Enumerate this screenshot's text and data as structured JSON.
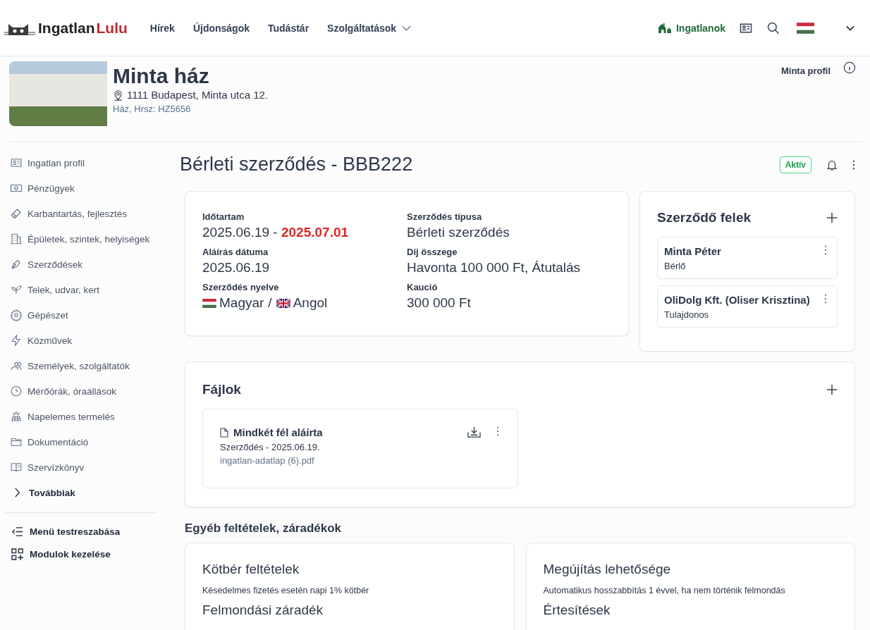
{
  "header": {
    "logo_first": "Ingatlan",
    "logo_second": "Lulu",
    "nav": [
      {
        "label": "Hírek",
        "dropdown": false
      },
      {
        "label": "Újdonságok",
        "dropdown": false
      },
      {
        "label": "Tudástár",
        "dropdown": false
      },
      {
        "label": "Szolgáltatások",
        "dropdown": true
      }
    ],
    "properties_link": "Ingatlanok"
  },
  "property": {
    "name": "Minta ház",
    "address": "1111 Budapest, Minta utca 12.",
    "subtitle": "Ház, Hrsz: HZ5656",
    "profile_link": "Minta profil"
  },
  "sidebar": {
    "items": [
      {
        "label": "Ingatlan profil"
      },
      {
        "label": "Pénzügyek"
      },
      {
        "label": "Karbantartás, fejlesztés"
      },
      {
        "label": "Épületek, szintek, helyiségek"
      },
      {
        "label": "Szerződések"
      },
      {
        "label": "Telek, udvar, kert"
      },
      {
        "label": "Gépészet"
      },
      {
        "label": "Közművek"
      },
      {
        "label": "Személyek, szolgáltatók"
      },
      {
        "label": "Mérőórák, óraállások"
      },
      {
        "label": "Napelemes termelés"
      },
      {
        "label": "Dokumentáció"
      },
      {
        "label": "Szervízkönyv"
      }
    ],
    "more": "Továbbiak",
    "actions": [
      "Menü testreszabása",
      "Modulok kezelése"
    ]
  },
  "contract": {
    "title": "Bérleti szerződés - BBB222",
    "status": "Aktív",
    "columns": [
      [
        {
          "kind": "text",
          "label": "Időtartam",
          "value": "2025.06.19 - **2025.07.01**"
        },
        {
          "kind": "text",
          "label": "Aláírás dátuma",
          "value": "2025.06.19"
        },
        {
          "kind": "languages",
          "label": "Szerződés nyelve",
          "separator": "/",
          "languages": [
            {
              "kind": "hu",
              "name": "Magyar"
            },
            {
              "kind": "gb",
              "name": "Angol"
            }
          ]
        }
      ],
      [
        {
          "kind": "text",
          "label": "Szerződés típusa",
          "value": "Bérleti szerződés"
        },
        {
          "kind": "text",
          "label": "Díj összege",
          "value": "Havonta 100 000 Ft, Átutalás"
        },
        {
          "kind": "text",
          "label": "Kaució",
          "value": "300 000 Ft"
        }
      ]
    ]
  },
  "parties": {
    "title": "Szerződő felek",
    "items": [
      {
        "name": "Minta Péter",
        "role": "Bérlő"
      },
      {
        "name": "OliDolg Kft. (Oliser Krisztina)",
        "role": "Tulajdonos"
      }
    ]
  },
  "files": {
    "title": "Fájlok",
    "items": [
      {
        "title": "Mindkét fél aláírta",
        "subtitle": "Szerződés - 2025.06.19.",
        "filename": "ingatlan-adatlap (6).pdf"
      }
    ]
  },
  "terms": {
    "heading": "Egyéb feltételek, záradékok",
    "cards": [
      [
        {
          "title": "Kötbér feltételek",
          "text": "Késedelmes fizetés esetén napi 1% kötbér"
        },
        {
          "title": "Felmondási záradék"
        }
      ],
      [
        {
          "title": "Megújítás lehetősége",
          "text": "Automatikus hosszabbítás 1 évvel, ha nem történik felmondás"
        },
        {
          "title": "Értesítések"
        }
      ]
    ]
  }
}
